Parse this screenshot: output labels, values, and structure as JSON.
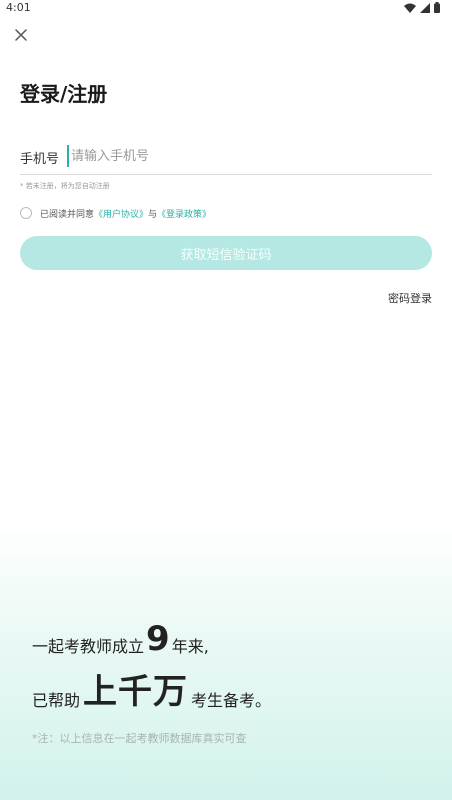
{
  "status_bar": {
    "time": "4:01",
    "icons": [
      "wifi-icon",
      "signal-icon",
      "battery-icon"
    ]
  },
  "header": {
    "close_icon": "close-icon",
    "title": "登录/注册"
  },
  "form": {
    "phone_label": "手机号",
    "phone_placeholder": "请输入手机号",
    "phone_value": "",
    "hint": "* 若未注册，将为您自动注册",
    "agree_prefix": "已阅读并同意",
    "user_agreement": "《用户协议》",
    "agree_and": "与",
    "login_policy": "《登录政策》",
    "sms_button": "获取短信验证码",
    "password_login": "密码登录"
  },
  "promo": {
    "line1_prefix": "一起考教师成立",
    "line1_number": "9",
    "line1_suffix": "年来,",
    "line2_prefix": "已帮助",
    "line2_highlight": "上千万",
    "line2_suffix": "考生备考。",
    "footnote": "*注：以上信息在一起考教师数据库真实可查"
  },
  "colors": {
    "accent": "#27b3a8",
    "button_bg": "#b5e7e3",
    "gradient_bottom": "#d2f2ec"
  }
}
